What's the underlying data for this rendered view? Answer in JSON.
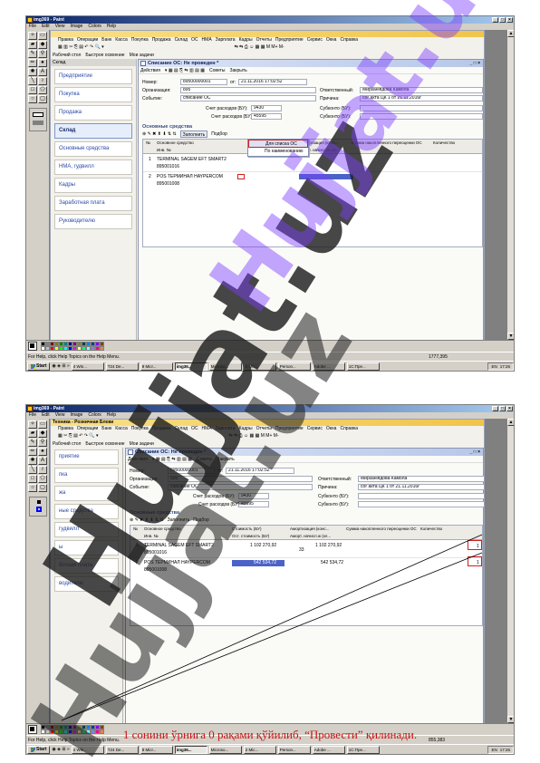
{
  "paint": {
    "title": "img369 - Paint",
    "menu": [
      "File",
      "Edit",
      "View",
      "Image",
      "Colors",
      "Help"
    ],
    "win_buttons": [
      "_",
      "□",
      "×"
    ],
    "status_text": "For Help, click Help Topics on the Help Menu.",
    "coords_1": "1777,395",
    "coords_2": "855,383"
  },
  "palette_colors": [
    "#000000",
    "#808080",
    "#800000",
    "#808000",
    "#008000",
    "#008080",
    "#000080",
    "#800080",
    "#808040",
    "#004040",
    "#0080ff",
    "#004080",
    "#8000ff",
    "#804000",
    "#ffffff",
    "#c0c0c0",
    "#ff0000",
    "#ffff00",
    "#00ff00",
    "#00ffff",
    "#0000ff",
    "#ff00ff",
    "#ffff80",
    "#00ff80",
    "#80ffff",
    "#8080ff",
    "#ff0080",
    "#ff8040"
  ],
  "taskbar": {
    "start": "Start",
    "tasks": [
      "4 Win...",
      "T24 De...",
      "8 Micr...",
      "img36...",
      "Microso...",
      "2 Mic...",
      "Person...",
      "Adobe ...",
      "1С:Пре..."
    ],
    "active_index": 3,
    "tray_lang": "EN",
    "time": "17:26"
  },
  "app": {
    "title": "Техника - Розничная Блоки",
    "menu": [
      "Правка",
      "Операции",
      "Банк",
      "Касса",
      "Покупка",
      "Продажа",
      "Склад",
      "ОС",
      "НМА",
      "Зарплата",
      "Кадры",
      "Отчеты",
      "Предприятие",
      "Сервис",
      "Окна",
      "Справка"
    ],
    "toolbar2": [
      "Рабочий стол",
      "Быстрое освоение",
      "Мои задачи"
    ],
    "nav_head": "Склад",
    "nav_items": [
      "Предприятие",
      "Покупка",
      "Продажа",
      "Склад",
      "Основные средства",
      "НМА, гудвилл",
      "Кадры",
      "Заработная плата",
      "Руководителю"
    ],
    "nav_items_2": [
      "приятие",
      "пка",
      "жа",
      "ные средства",
      "гудвилл",
      "ы",
      "ботная плата",
      "водителю"
    ]
  },
  "doc": {
    "title_1": "Списание ОС: Не проведен *",
    "title_2": "Списание ОС: Не проведен *",
    "toolbar": [
      "Действия",
      "Советы",
      "Закрыть"
    ],
    "number_label": "Номер:",
    "number_value": "89500000001",
    "date_label": "от:",
    "date_value": "21.11.2016 17:02:52",
    "org_label": "Организация:",
    "org_value": "895",
    "event_label": "Событие:",
    "event_value": "списание ОС",
    "resp_label": "Ответственный:",
    "resp_value": "Мирзанiядова Камола",
    "reason_label": "Причина:",
    "reason_value": "сог акта ЦК 1 от 21.11.2016г",
    "acct_exp_label": "Счет расходов (БУ):",
    "acct_exp_value": "9430",
    "acct_exp_label_2": "Счет расходов (БУ):",
    "acct_exp_value_2": "45595",
    "subconto_label": "Субконто (БУ):",
    "section": "Основные средства",
    "table_toolbar": [
      "Заполнить",
      "Подбор"
    ],
    "cols": [
      "№",
      "Основное средство",
      "Инв. №",
      "Стоимость (БУ)",
      "Ост. стоимость (БУ)",
      "Амортизация (конс...",
      "Аморт. начисл.ж (кл...",
      "Сумма накопленного переоценки ОС",
      "Количество"
    ],
    "rows": [
      {
        "n": "1",
        "os": "TERMINAL SAGEM EFT SMART2",
        "inv": "895001016",
        "cost": "1 102 270,92",
        "amort": "1 102 270,92",
        "mid": "33",
        "qty": "1"
      },
      {
        "n": "2",
        "os": "POS ТЕРМИНАЛ HAYPERCOM",
        "inv": "895001008",
        "cost": "542 534,72",
        "amort": "542 534,72",
        "qty": "1"
      }
    ],
    "dropdown": [
      "Для списка ОС",
      "По наименованию"
    ]
  },
  "watermark": "Hujjat.uz",
  "caption": "1 сонини ўрнига 0 рақами қўйилиб, “Провести” қилинади.",
  "colors": {
    "accent_red": "#d31e1e",
    "watermark": "#1e1e1e",
    "watermark_violet": "#7c3cff",
    "caption": "#cc1010",
    "selection": "#4b63c8"
  }
}
